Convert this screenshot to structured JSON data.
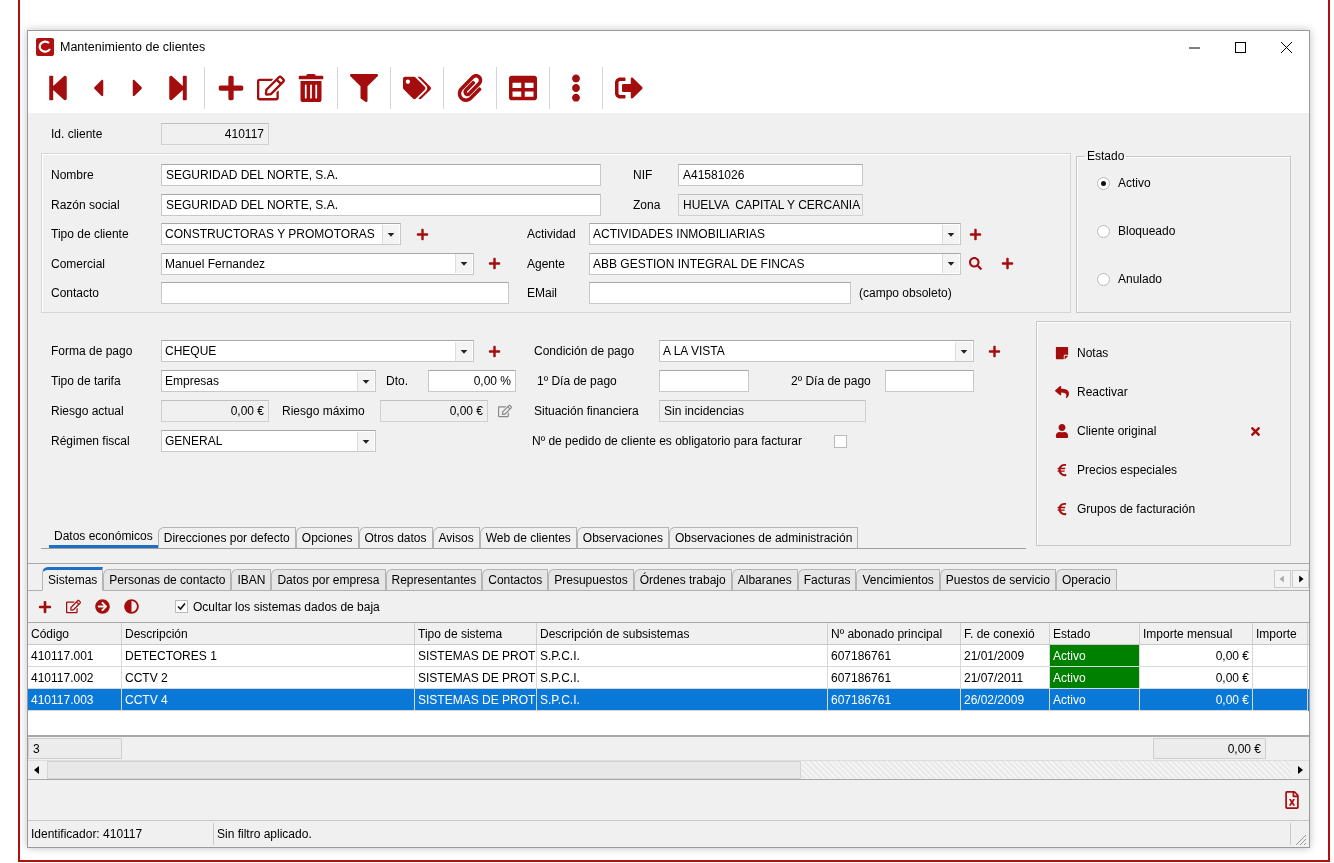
{
  "window": {
    "title": "Mantenimiento de clientes"
  },
  "id_cliente": {
    "label": "Id. cliente",
    "value": "410117"
  },
  "client_rows": [
    {
      "items": [
        {
          "kind": "label",
          "text": "Nombre"
        },
        {
          "kind": "text",
          "value": "SEGURIDAD DEL NORTE, S.A."
        },
        {
          "kind": "label",
          "text": "NIF"
        },
        {
          "kind": "text",
          "value": "A41581026"
        }
      ]
    },
    {
      "items": [
        {
          "kind": "label",
          "text": "Razón social"
        },
        {
          "kind": "text",
          "value": "SEGURIDAD DEL NORTE, S.A."
        },
        {
          "kind": "label",
          "text": "Zona"
        },
        {
          "kind": "readonly",
          "value": "HUELVA  CAPITAL Y CERCANIA"
        }
      ]
    },
    {
      "items": [
        {
          "kind": "label",
          "text": "Tipo de cliente"
        },
        {
          "kind": "dropdown",
          "value": "CONSTRUCTORAS Y PROMOTORAS"
        },
        {
          "kind": "add"
        },
        {
          "kind": "label",
          "text": "Actividad"
        },
        {
          "kind": "dropdown",
          "value": "ACTIVIDADES INMOBILIARIAS"
        },
        {
          "kind": "add"
        }
      ]
    },
    {
      "items": [
        {
          "kind": "label",
          "text": "Comercial"
        },
        {
          "kind": "dropdown",
          "value": "Manuel Fernandez"
        },
        {
          "kind": "add"
        },
        {
          "kind": "label",
          "text": "Agente"
        },
        {
          "kind": "dropdown",
          "value": "ABB GESTION INTEGRAL DE FINCAS"
        },
        {
          "kind": "search"
        },
        {
          "kind": "add"
        }
      ]
    },
    {
      "items": [
        {
          "kind": "label",
          "text": "Contacto"
        },
        {
          "kind": "text"
        },
        {
          "kind": "label",
          "text": "EMail"
        },
        {
          "kind": "text"
        },
        {
          "kind": "note",
          "text": "(campo obsoleto)"
        }
      ]
    }
  ],
  "estado": {
    "title": "Estado",
    "options": [
      {
        "label": "Activo",
        "selected": true
      },
      {
        "label": "Bloqueado",
        "selected": false
      },
      {
        "label": "Anulado",
        "selected": false
      }
    ]
  },
  "payment_rows": [
    {
      "items": [
        {
          "kind": "label",
          "text": "Forma de pago"
        },
        {
          "kind": "dropdown",
          "value": "CHEQUE"
        },
        {
          "kind": "add"
        },
        {
          "kind": "label",
          "text": "Condición de pago"
        },
        {
          "kind": "dropdown",
          "value": "A LA VISTA"
        },
        {
          "kind": "add"
        }
      ]
    },
    {
      "items": [
        {
          "kind": "label",
          "text": "Tipo de tarifa"
        },
        {
          "kind": "dropdown",
          "value": "Empresas"
        },
        {
          "kind": "label",
          "text": "Dto."
        },
        {
          "kind": "number",
          "value": "0,00 %"
        },
        {
          "kind": "label",
          "text": "1º Día de pago"
        },
        {
          "kind": "text"
        },
        {
          "kind": "label",
          "text": "2º Día de pago"
        },
        {
          "kind": "text"
        }
      ]
    },
    {
      "items": [
        {
          "kind": "label",
          "text": "Riesgo actual"
        },
        {
          "kind": "readonly_number",
          "value": "0,00 €"
        },
        {
          "kind": "label",
          "text": "Riesgo máximo"
        },
        {
          "kind": "readonly_number",
          "value": "0,00 €"
        },
        {
          "kind": "edit"
        },
        {
          "kind": "label",
          "text": "Situación financiera"
        },
        {
          "kind": "readonly",
          "value": "Sin incidencias"
        }
      ]
    },
    {
      "items": [
        {
          "kind": "label",
          "text": "Régimen fiscal"
        },
        {
          "kind": "dropdown",
          "value": "GENERAL"
        },
        {
          "kind": "label",
          "text": "Nº de pedido de cliente es obligatorio para facturar"
        },
        {
          "kind": "checkbox",
          "checked": false
        }
      ]
    }
  ],
  "form_tabs": [
    {
      "label": "Datos económicos",
      "selected": true
    },
    {
      "label": "Direcciones por defecto",
      "selected": false
    },
    {
      "label": "Opciones",
      "selected": false
    },
    {
      "label": "Otros datos",
      "selected": false
    },
    {
      "label": "Avisos",
      "selected": false
    },
    {
      "label": "Web de clientes",
      "selected": false
    },
    {
      "label": "Observaciones",
      "selected": false
    },
    {
      "label": "Observaciones de administración",
      "selected": false
    }
  ],
  "actions": [
    {
      "label": "Notas",
      "kind": "note",
      "clear": false
    },
    {
      "label": "Reactivar",
      "kind": "undo",
      "clear": false
    },
    {
      "label": "Cliente original",
      "kind": "user",
      "clear": true
    },
    {
      "label": "Precios especiales",
      "kind": "euro",
      "clear": false
    },
    {
      "label": "Grupos de facturación",
      "kind": "euro",
      "clear": false
    }
  ],
  "lower_tabs": [
    {
      "label": "Sistemas",
      "selected": true
    },
    {
      "label": "Personas de contacto",
      "selected": false
    },
    {
      "label": "IBAN",
      "selected": false
    },
    {
      "label": "Datos por empresa",
      "selected": false
    },
    {
      "label": "Representantes",
      "selected": false
    },
    {
      "label": "Contactos",
      "selected": false
    },
    {
      "label": "Presupuestos",
      "selected": false
    },
    {
      "label": "Órdenes trabajo",
      "selected": false
    },
    {
      "label": "Albaranes",
      "selected": false
    },
    {
      "label": "Facturas",
      "selected": false
    },
    {
      "label": "Vencimientos",
      "selected": false
    },
    {
      "label": "Puestos de servicio",
      "selected": false
    },
    {
      "label": "Operacio",
      "selected": false
    }
  ],
  "hide_inactive": {
    "label": "Ocultar los sistemas dados de baja",
    "checked": true
  },
  "table": {
    "columns": [
      "Código",
      "Descripción",
      "Tipo de sistema",
      "Descripción de subsistemas",
      "Nº abonado principal",
      "F. de conexió",
      "Estado",
      "Importe mensual",
      "Importe"
    ],
    "rows": [
      {
        "cells": [
          "410117.001",
          "DETECTORES 1",
          "SISTEMAS DE PROT",
          "S.P.C.I.",
          "607186761",
          "21/01/2009",
          "Activo",
          "0,00 €"
        ],
        "selected": false,
        "color": "#008000"
      },
      {
        "cells": [
          "410117.002",
          "CCTV 2",
          "SISTEMAS DE PROT",
          "S.P.C.I.",
          "607186761",
          "21/07/2011",
          "Activo",
          "0,00 €"
        ],
        "selected": false,
        "color": "#008000"
      },
      {
        "cells": [
          "410117.003",
          "CCTV 4",
          "SISTEMAS DE PROT",
          "S.P.C.I.",
          "607186761",
          "26/02/2009",
          "Activo",
          "0,00 €"
        ],
        "selected": true
      }
    ],
    "footer": {
      "count": "3",
      "total": "0,00 €"
    }
  },
  "status_bar": [
    "Identificador: 410117",
    "Sin filtro aplicado."
  ]
}
